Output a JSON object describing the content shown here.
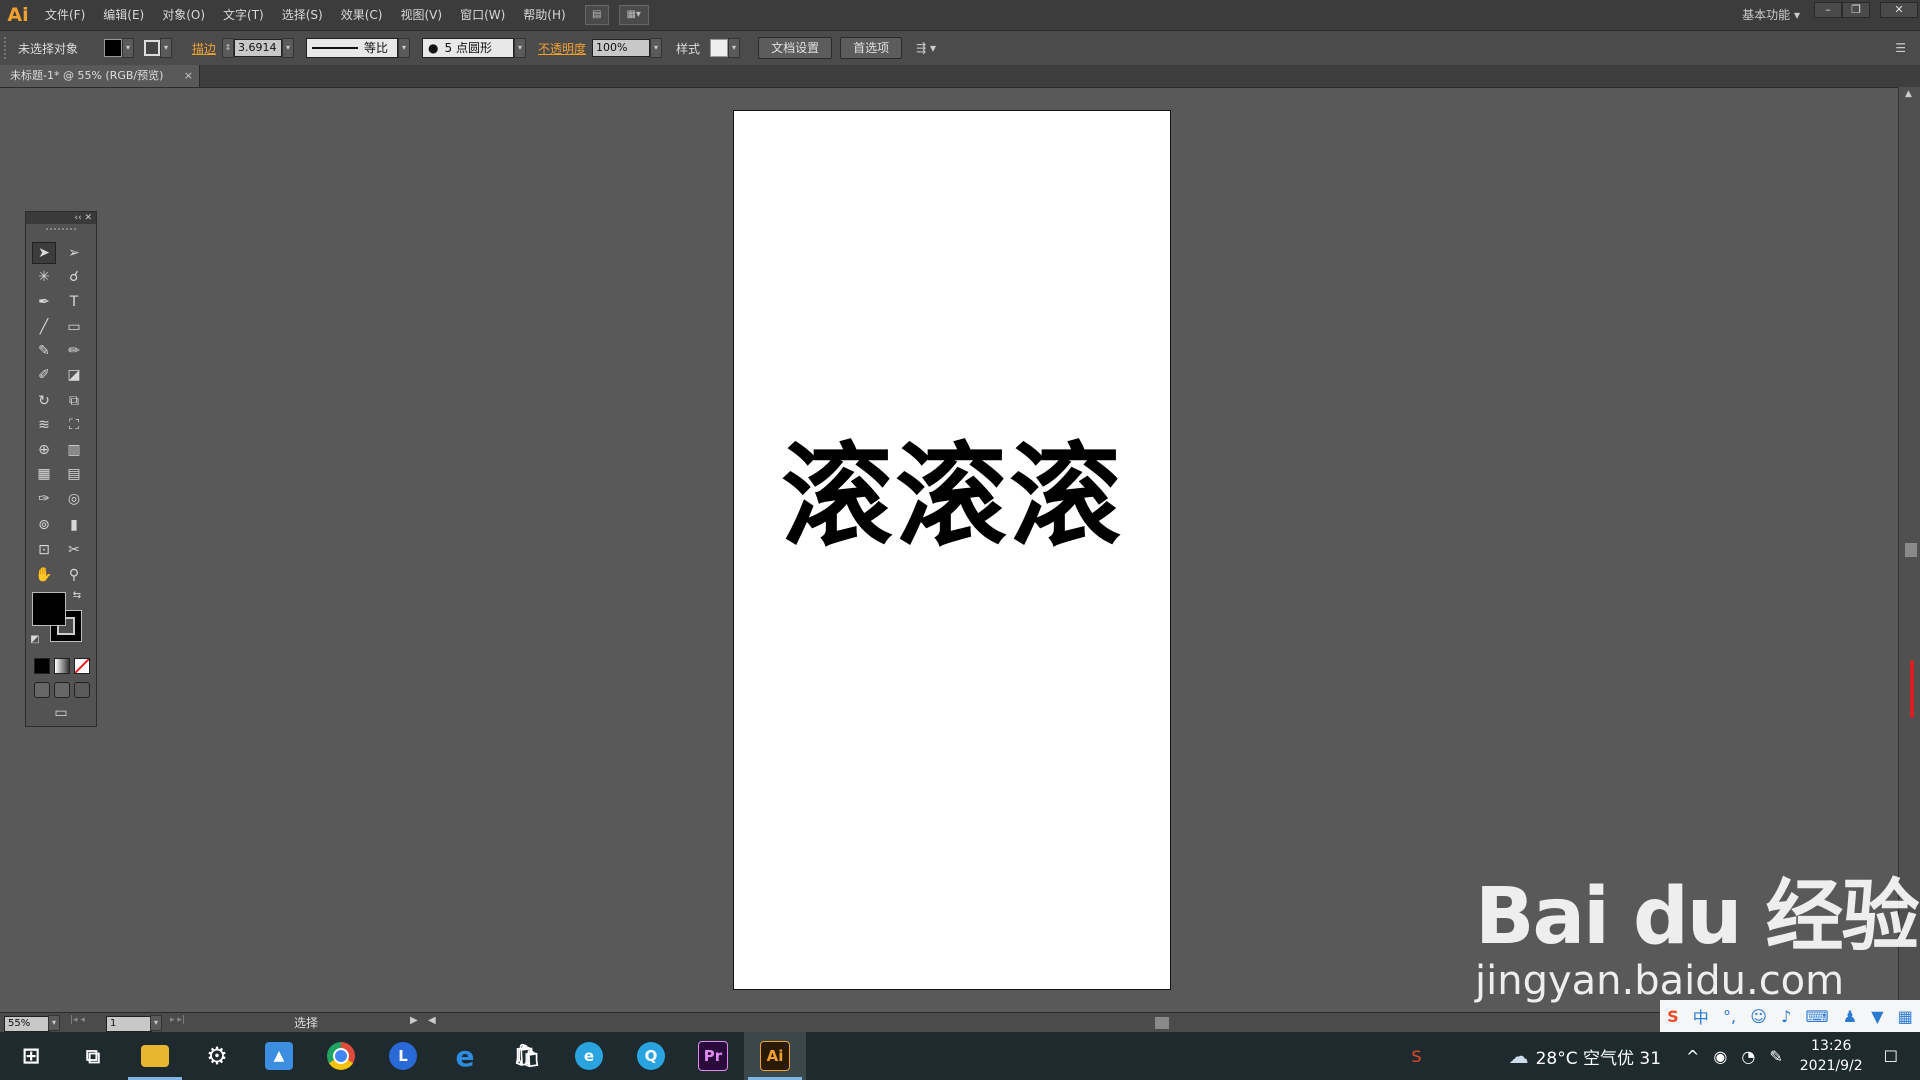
{
  "app": {
    "logo": "Ai"
  },
  "menu": [
    {
      "label": "文件(F)"
    },
    {
      "label": "编辑(E)"
    },
    {
      "label": "对象(O)"
    },
    {
      "label": "文字(T)"
    },
    {
      "label": "选择(S)"
    },
    {
      "label": "效果(C)"
    },
    {
      "label": "视图(V)"
    },
    {
      "label": "窗口(W)"
    },
    {
      "label": "帮助(H)"
    }
  ],
  "workspace": {
    "label": "基本功能"
  },
  "window_controls": {
    "minimize": "–",
    "restore": "❐",
    "close": "✕"
  },
  "control": {
    "selection_label": "未选择对象",
    "stroke_link": "描边",
    "stroke_weight": "3.6914",
    "profile_label": "等比",
    "brush_label": "5 点圆形",
    "opacity_link": "不透明度",
    "opacity_value": "100%",
    "style_label": "样式",
    "doc_setup_button": "文档设置",
    "preferences_button": "首选项"
  },
  "document": {
    "tab_title": "未标题-1* @ 55% (RGB/预览)",
    "close_glyph": "×"
  },
  "artwork": {
    "text": "滚滚滚"
  },
  "status": {
    "zoom": "55%",
    "artboard": "1",
    "tool": "选择"
  },
  "taskbar": {
    "items": [
      {
        "name": "start",
        "glyph": "⊞",
        "color": "#ffffff"
      },
      {
        "name": "task-view",
        "glyph": "⧉",
        "color": "#ffffff"
      },
      {
        "name": "file-explorer",
        "glyph": "▬",
        "color": "#e8b730"
      },
      {
        "name": "settings",
        "glyph": "⚙",
        "color": "#ffffff"
      },
      {
        "name": "photos",
        "glyph": "▲",
        "color": "#3b8ee0"
      },
      {
        "name": "chrome",
        "glyph": "●",
        "color": "#e24b3b"
      },
      {
        "name": "lark",
        "glyph": "L",
        "color": "#2a6ad8"
      },
      {
        "name": "internet-explorer",
        "glyph": "e",
        "color": "#2d8be0"
      },
      {
        "name": "store",
        "glyph": "▣",
        "color": "#ffffff"
      },
      {
        "name": "edge",
        "glyph": "e",
        "color": "#2aa4e0"
      },
      {
        "name": "qq-browser",
        "glyph": "Q",
        "color": "#2aa4e0"
      },
      {
        "name": "premiere",
        "glyph": "Pr",
        "color": "#2a0a3a"
      },
      {
        "name": "illustrator",
        "glyph": "Ai",
        "color": "#2a1a00"
      }
    ],
    "weather": "28°C  空气优 31",
    "time": "13:26",
    "date": "2021/9/2"
  },
  "watermark": {
    "main": "Bai du 经验",
    "sub": "jingyan.baidu.com"
  },
  "colors": {
    "accent": "#f0a030",
    "canvas": "#595959",
    "taskbar": "#1e2a2e"
  }
}
